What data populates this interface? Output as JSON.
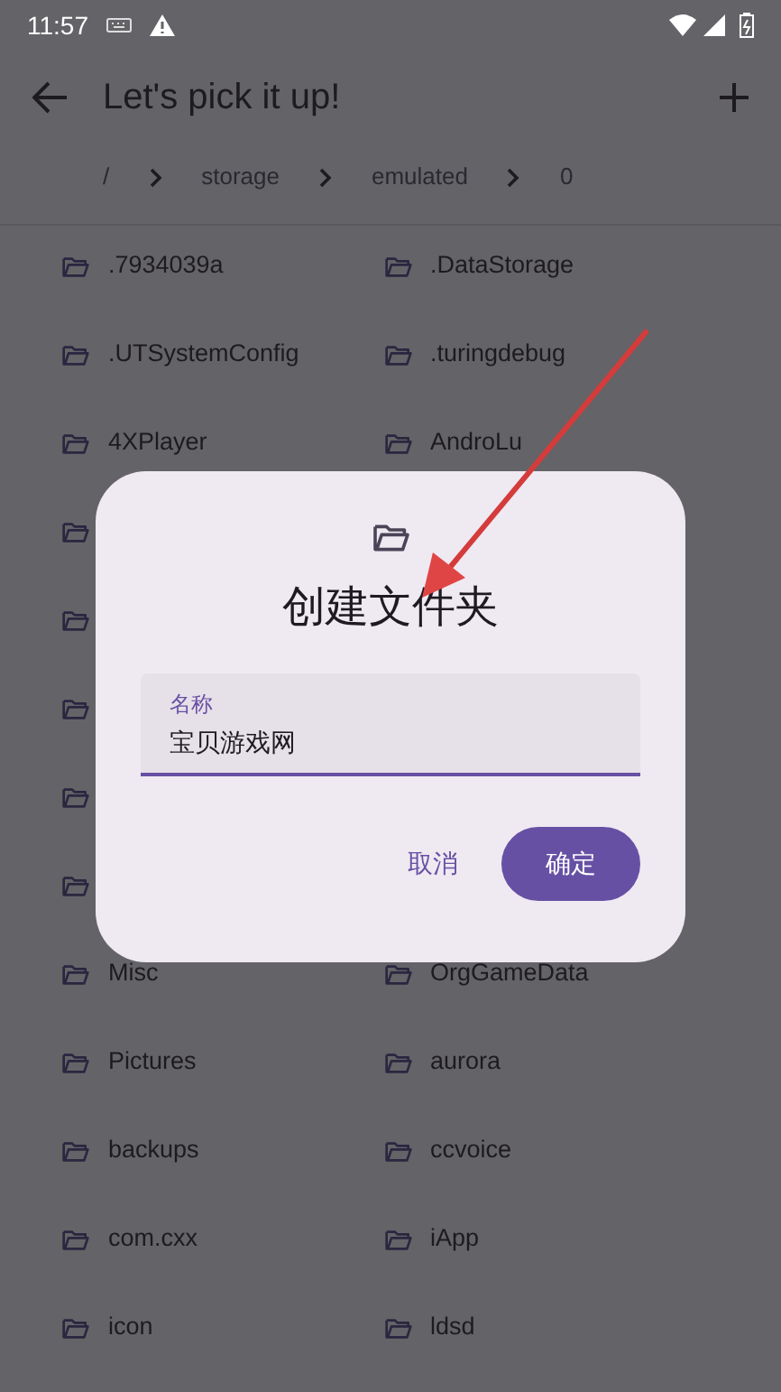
{
  "status_bar": {
    "time": "11:57"
  },
  "app_bar": {
    "title": "Let's pick it up!"
  },
  "breadcrumb": [
    {
      "label": "/"
    },
    {
      "label": "storage"
    },
    {
      "label": "emulated"
    },
    {
      "label": "0"
    }
  ],
  "folders": [
    {
      "left": {
        "kind": "folder",
        "name": ".7934039a"
      },
      "right": {
        "kind": "folder",
        "name": ".DataStorage"
      }
    },
    {
      "left": {
        "kind": "folder",
        "name": ".UTSystemConfig"
      },
      "right": {
        "kind": "folder",
        "name": ".turingdebug"
      }
    },
    {
      "left": {
        "kind": "folder",
        "name": "4XPlayer"
      },
      "right": {
        "kind": "folder",
        "name": "AndroLu"
      }
    },
    {
      "left": {
        "kind": "covered"
      }
    },
    {
      "left": {
        "kind": "covered"
      }
    },
    {
      "left": {
        "kind": "covered"
      }
    },
    {
      "left": {
        "kind": "covered"
      }
    },
    {
      "left": {
        "kind": "covered"
      }
    },
    {
      "left": {
        "kind": "folder",
        "name": "Misc"
      },
      "right": {
        "kind": "folder",
        "name": "OrgGameData"
      }
    },
    {
      "left": {
        "kind": "folder",
        "name": "Pictures"
      },
      "right": {
        "kind": "folder",
        "name": "aurora"
      }
    },
    {
      "left": {
        "kind": "folder",
        "name": "backups"
      },
      "right": {
        "kind": "folder",
        "name": "ccvoice"
      }
    },
    {
      "left": {
        "kind": "folder",
        "name": "com.cxx"
      },
      "right": {
        "kind": "folder",
        "name": "iApp"
      }
    },
    {
      "left": {
        "kind": "folder",
        "name": "icon"
      },
      "right": {
        "kind": "folder",
        "name": "ldsd"
      }
    }
  ],
  "dialog": {
    "title": "创建文件夹",
    "field": {
      "label": "名称",
      "value": "宝贝游戏网"
    },
    "buttons": [
      {
        "kind": "text",
        "label": "取消"
      },
      {
        "kind": "filled",
        "label": "确定"
      }
    ]
  },
  "arrow_annotation": true
}
